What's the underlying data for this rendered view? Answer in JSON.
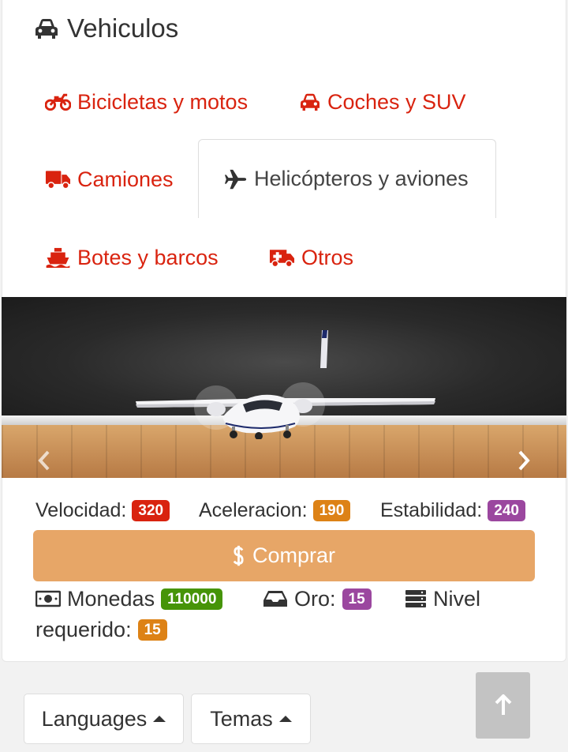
{
  "page": {
    "title": "Vehiculos",
    "title_icon": "car-icon"
  },
  "tabs": [
    {
      "label": "Bicicletas y motos",
      "icon": "motorcycle-icon",
      "active": false
    },
    {
      "label": "Coches y SUV",
      "icon": "car-icon",
      "active": false
    },
    {
      "label": "Camiones",
      "icon": "truck-icon",
      "active": false
    },
    {
      "label": "Helicópteros y aviones",
      "icon": "plane-icon",
      "active": true
    },
    {
      "label": "Botes y barcos",
      "icon": "ship-icon",
      "active": false
    },
    {
      "label": "Otros",
      "icon": "ambulance-icon",
      "active": false
    }
  ],
  "carousel": {
    "prev_icon": "chevron-left-icon",
    "next_icon": "chevron-right-icon"
  },
  "stats": {
    "speed_label": "Velocidad:",
    "speed_value": "320",
    "accel_label": "Aceleracion:",
    "accel_value": "190",
    "stability_label": "Estabilidad:",
    "stability_value": "240"
  },
  "buy_button": {
    "label": "Comprar",
    "icon": "dollar-icon"
  },
  "requirements": {
    "coins_label": "Monedas",
    "coins_value": "110000",
    "coins_icon": "money-icon",
    "gold_label": "Oro:",
    "gold_value": "15",
    "gold_icon": "inbox-icon",
    "level_label_1": "Nivel",
    "level_label_2": "requerido:",
    "level_value": "15",
    "level_icon": "server-icon"
  },
  "footer": {
    "languages_label": "Languages",
    "themes_label": "Temas",
    "back_to_top_icon": "arrow-up-icon"
  },
  "colors": {
    "accent_red": "#d9230f",
    "badge_orange": "#dd8216",
    "badge_purple": "#9b479f",
    "badge_green": "#469408",
    "buy_button": "#e7a667"
  }
}
